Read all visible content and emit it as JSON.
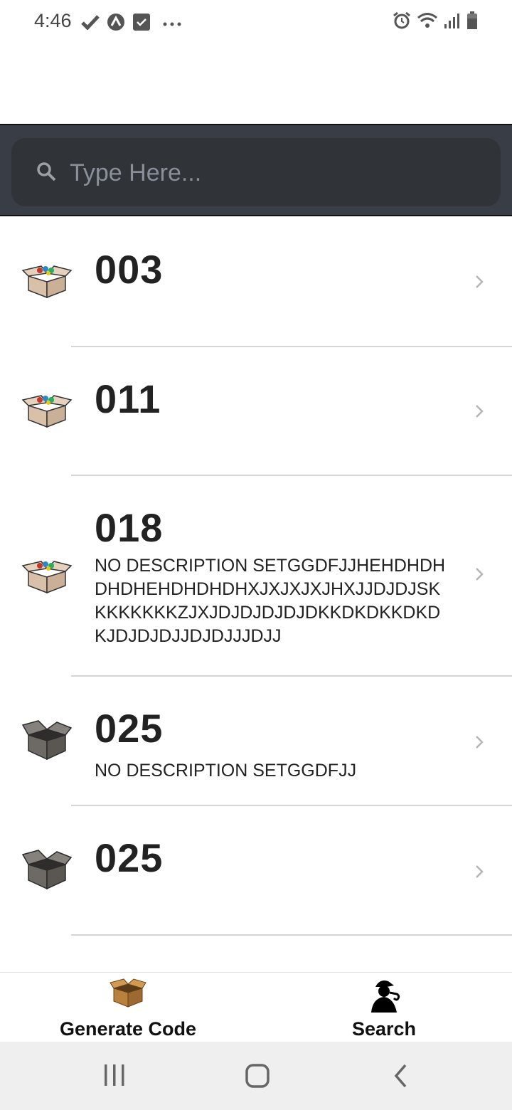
{
  "status_bar": {
    "time": "4:46",
    "left_icons": [
      "check-icon",
      "app-a-icon",
      "task-check-icon",
      "more-dots-icon"
    ],
    "right_icons": [
      "alarm-icon",
      "wifi-icon",
      "signal-icon",
      "battery-icon"
    ]
  },
  "search": {
    "placeholder": "Type Here...",
    "value": ""
  },
  "list": {
    "items": [
      {
        "title": "003",
        "description": "",
        "icon": "box-open-full-icon"
      },
      {
        "title": "011",
        "description": "",
        "icon": "box-open-full-icon"
      },
      {
        "title": "018",
        "description": "NO DESCRIPTION SETGGDFJJHEHDHDHDHDHEHDHDHDHXJXJXJXJHXJJDJDJSKKKKKKKKZJXJDJDJDJDJDKKDKDKKDKDKJDJDJDJJDJDJJJDJJ",
        "icon": "box-open-full-icon"
      },
      {
        "title": "025",
        "description": "NO DESCRIPTION SETGGDFJJ",
        "icon": "box-open-empty-icon"
      },
      {
        "title": "025",
        "description": "",
        "icon": "box-open-empty-icon"
      }
    ]
  },
  "tab_bar": {
    "tabs": [
      {
        "label": "Generate Code",
        "icon": "cardboard-box-icon"
      },
      {
        "label": "Search",
        "icon": "detective-icon"
      }
    ]
  },
  "nav_bar": {
    "buttons": [
      "recent-apps-icon",
      "home-icon",
      "back-icon"
    ]
  },
  "colors": {
    "search_band": "#393e46",
    "search_box": "#303338",
    "text_primary": "#222222",
    "nav_bg": "#efefef"
  }
}
